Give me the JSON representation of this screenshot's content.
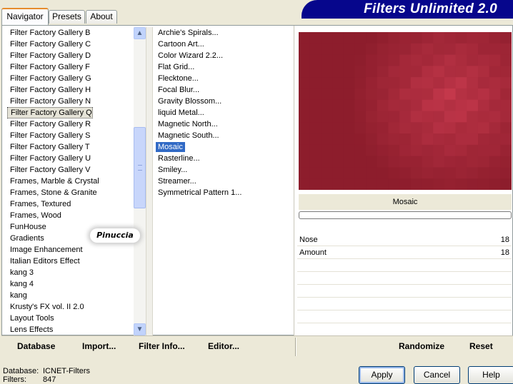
{
  "app_title": "Filters Unlimited 2.0",
  "tabs": [
    {
      "label": "Navigator",
      "active": true
    },
    {
      "label": "Presets",
      "active": false
    },
    {
      "label": "About",
      "active": false
    }
  ],
  "categories": {
    "items": [
      "Filter Factory Gallery B",
      "Filter Factory Gallery C",
      "Filter Factory Gallery D",
      "Filter Factory Gallery F",
      "Filter Factory Gallery G",
      "Filter Factory Gallery H",
      "Filter Factory Gallery N",
      "Filter Factory Gallery Q",
      "Filter Factory Gallery R",
      "Filter Factory Gallery S",
      "Filter Factory Gallery T",
      "Filter Factory Gallery U",
      "Filter Factory Gallery V",
      "Frames, Marble & Crystal",
      "Frames, Stone & Granite",
      "Frames, Textured",
      "Frames, Wood",
      "FunHouse",
      "Gradients",
      "Image Enhancement",
      "Italian Editors Effect",
      "kang 3",
      "kang 4",
      "kang",
      "Krusty's FX vol. II 2.0",
      "Layout Tools",
      "Lens Effects"
    ],
    "selected_index": 7
  },
  "filters": {
    "items": [
      "Archie's Spirals...",
      "Cartoon Art...",
      "Color Wizard 2.2...",
      "Flat Grid...",
      "Flecktone...",
      "Focal Blur...",
      "Gravity Blossom...",
      "liquid Metal...",
      "Magnetic North...",
      "Magnetic South...",
      "Mosaic",
      "Rasterline...",
      "Smiley...",
      "Streamer...",
      "Symmetrical Pattern 1..."
    ],
    "selected_index": 10
  },
  "preview": {
    "filter_name": "Mosaic",
    "base_color": "#8d1d2c",
    "highlight_color": "#c83a4e"
  },
  "params": [
    {
      "name": "Nose",
      "value": "18"
    },
    {
      "name": "Amount",
      "value": "18"
    }
  ],
  "toolbar": {
    "database": "Database",
    "import": "Import...",
    "filter_info": "Filter Info...",
    "editor": "Editor...",
    "randomize": "Randomize",
    "reset": "Reset"
  },
  "status": {
    "database_label": "Database:",
    "database_value": "ICNET-Filters",
    "filters_label": "Filters:",
    "filters_value": "847"
  },
  "buttons": {
    "apply": "Apply",
    "cancel": "Cancel",
    "help": "Help"
  },
  "watermark": "Pinuccia",
  "colors": {
    "title_banner": "#06068c",
    "selection": "#316ac5",
    "window_bg": "#ece9d8"
  }
}
